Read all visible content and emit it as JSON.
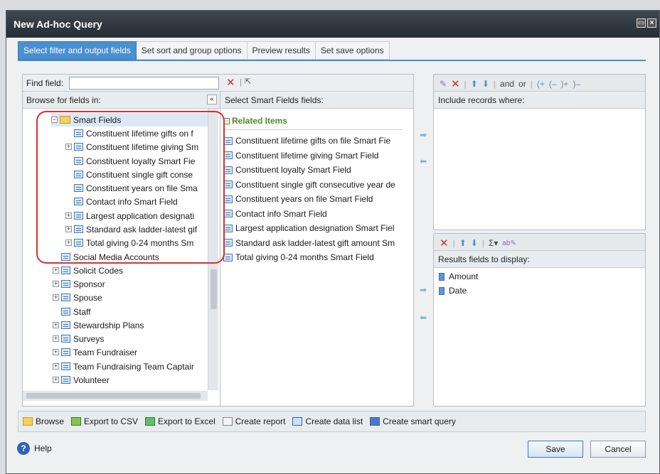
{
  "dialog": {
    "title": "New Ad-hoc Query",
    "tabs": [
      "Select filter and output fields",
      "Set sort and group options",
      "Preview results",
      "Set save options"
    ],
    "active_tab": 0
  },
  "browse": {
    "find_label": "Find field:",
    "find_value": "",
    "header": "Browse for fields in:",
    "collapse_glyph": "«",
    "tree": [
      {
        "label": "Smart Fields",
        "expander": "⊟",
        "type": "folder",
        "level": 0
      },
      {
        "label": "Constituent lifetime gifts on f",
        "type": "field",
        "level": 1
      },
      {
        "label": "Constituent lifetime giving Sm",
        "type": "field",
        "level": 1,
        "expander": "+"
      },
      {
        "label": "Constituent loyalty Smart Fie",
        "type": "field",
        "level": 1
      },
      {
        "label": "Constituent single gift conse",
        "type": "field",
        "level": 1
      },
      {
        "label": "Constituent years on file Sma",
        "type": "field",
        "level": 1
      },
      {
        "label": "Contact info Smart Field",
        "type": "field",
        "level": 1
      },
      {
        "label": "Largest application designati",
        "type": "field",
        "level": 1,
        "expander": "+"
      },
      {
        "label": "Standard ask ladder-latest gif",
        "type": "field",
        "level": 1,
        "expander": "+"
      },
      {
        "label": "Total giving 0-24 months Sm",
        "type": "field",
        "level": 1,
        "expander": "+"
      },
      {
        "label": "Social Media Accounts",
        "type": "field",
        "level": 0
      },
      {
        "label": "Solicit Codes",
        "type": "field",
        "level": 0,
        "expander": "+"
      },
      {
        "label": "Sponsor",
        "type": "field",
        "level": 0,
        "expander": "+"
      },
      {
        "label": "Spouse",
        "type": "field",
        "level": 0,
        "expander": "+"
      },
      {
        "label": "Staff",
        "type": "field",
        "level": 0
      },
      {
        "label": "Stewardship Plans",
        "type": "field",
        "level": 0,
        "expander": "+"
      },
      {
        "label": "Surveys",
        "type": "field",
        "level": 0,
        "expander": "+"
      },
      {
        "label": "Team Fundraiser",
        "type": "field",
        "level": 0,
        "expander": "+"
      },
      {
        "label": "Team Fundraising Team Captair",
        "type": "field",
        "level": 0,
        "expander": "+"
      },
      {
        "label": "Volunteer",
        "type": "field",
        "level": 0,
        "expander": "+"
      }
    ]
  },
  "middle": {
    "header": "Select Smart Fields fields:",
    "group_label": "Related Items",
    "items": [
      "Constituent lifetime gifts on file Smart Fie",
      "Constituent lifetime giving Smart Field",
      "Constituent loyalty Smart Field",
      "Constituent single gift consecutive year de",
      "Constituent years on file Smart Field",
      "Contact info Smart Field",
      "Largest application designation Smart Fiel",
      "Standard ask ladder-latest gift amount Sm",
      "Total giving 0-24 months Smart Field"
    ]
  },
  "filter": {
    "toolbar_and": "and",
    "toolbar_or": "or",
    "toolbar_paren_open": "(+",
    "toolbar_paren_open_minus": "(–",
    "toolbar_paren_close": ")+",
    "toolbar_paren_close_minus": ")–",
    "header": "Include records where:"
  },
  "results": {
    "header": "Results fields to display:",
    "sigma": "Σ▾",
    "items": [
      "Amount",
      "Date"
    ]
  },
  "bottom_bar": [
    "Browse",
    "Export to CSV",
    "Export to Excel",
    "Create report",
    "Create data list",
    "Create smart query"
  ],
  "footer": {
    "help": "Help",
    "save": "Save",
    "cancel": "Cancel"
  },
  "colors": {
    "active_tab": "#4a8fd0",
    "callout": "#d83030",
    "titlebar": "#2e3540"
  }
}
